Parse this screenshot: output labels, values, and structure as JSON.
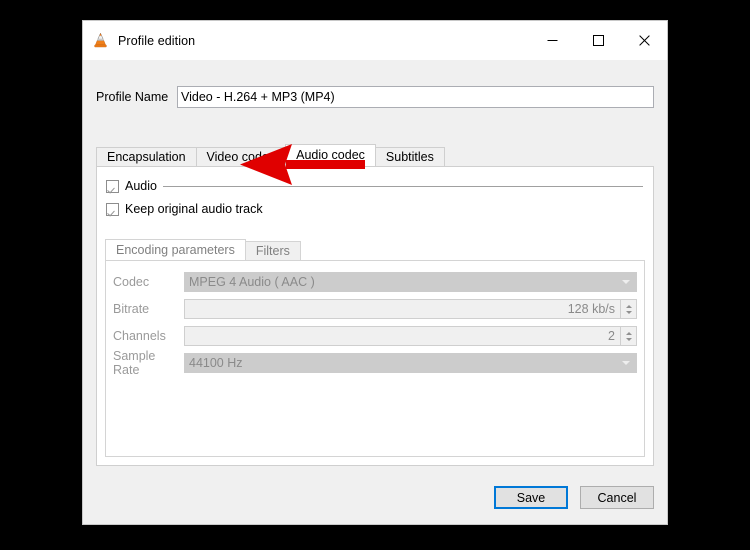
{
  "window": {
    "title": "Profile edition",
    "app_icon": "vlc-cone-icon",
    "controls": {
      "minimize": "minimize-icon",
      "maximize": "maximize-icon",
      "close": "close-icon"
    }
  },
  "profile": {
    "label": "Profile Name",
    "value": "Video - H.264 + MP3 (MP4)",
    "placeholder": ""
  },
  "tabs": [
    {
      "label": "Encapsulation",
      "active": false
    },
    {
      "label": "Video codec",
      "active": false
    },
    {
      "label": "Audio codec",
      "active": true
    },
    {
      "label": "Subtitles",
      "active": false
    }
  ],
  "audio_tab": {
    "group_checkbox": {
      "label": "Audio",
      "checked": true
    },
    "keep_original": {
      "label": "Keep original audio track",
      "checked": true
    },
    "inner_tabs": [
      {
        "label": "Encoding parameters",
        "active": true
      },
      {
        "label": "Filters",
        "active": false
      }
    ],
    "fields": [
      {
        "name": "codec",
        "label": "Codec",
        "type": "combo",
        "value": "MPEG 4 Audio ( AAC )",
        "disabled": true
      },
      {
        "name": "bitrate",
        "label": "Bitrate",
        "type": "spin",
        "value": "128 kb/s",
        "disabled": true
      },
      {
        "name": "channels",
        "label": "Channels",
        "type": "spin",
        "value": "2",
        "disabled": true
      },
      {
        "name": "samplerate",
        "label": "Sample Rate",
        "type": "combo",
        "value": "44100 Hz",
        "disabled": true
      }
    ]
  },
  "footer": {
    "save_label": "Save",
    "cancel_label": "Cancel"
  },
  "annotation": {
    "type": "arrow",
    "direction": "left",
    "color": "#e00000",
    "points_at": "Keep original audio track"
  },
  "colors": {
    "accent": "#0078d7",
    "window_bg": "#f0f0f0",
    "panel_bg": "#ffffff",
    "disabled_fill": "#cccccc",
    "disabled_text": "#8a8a8a",
    "annotation_red": "#e00000"
  }
}
